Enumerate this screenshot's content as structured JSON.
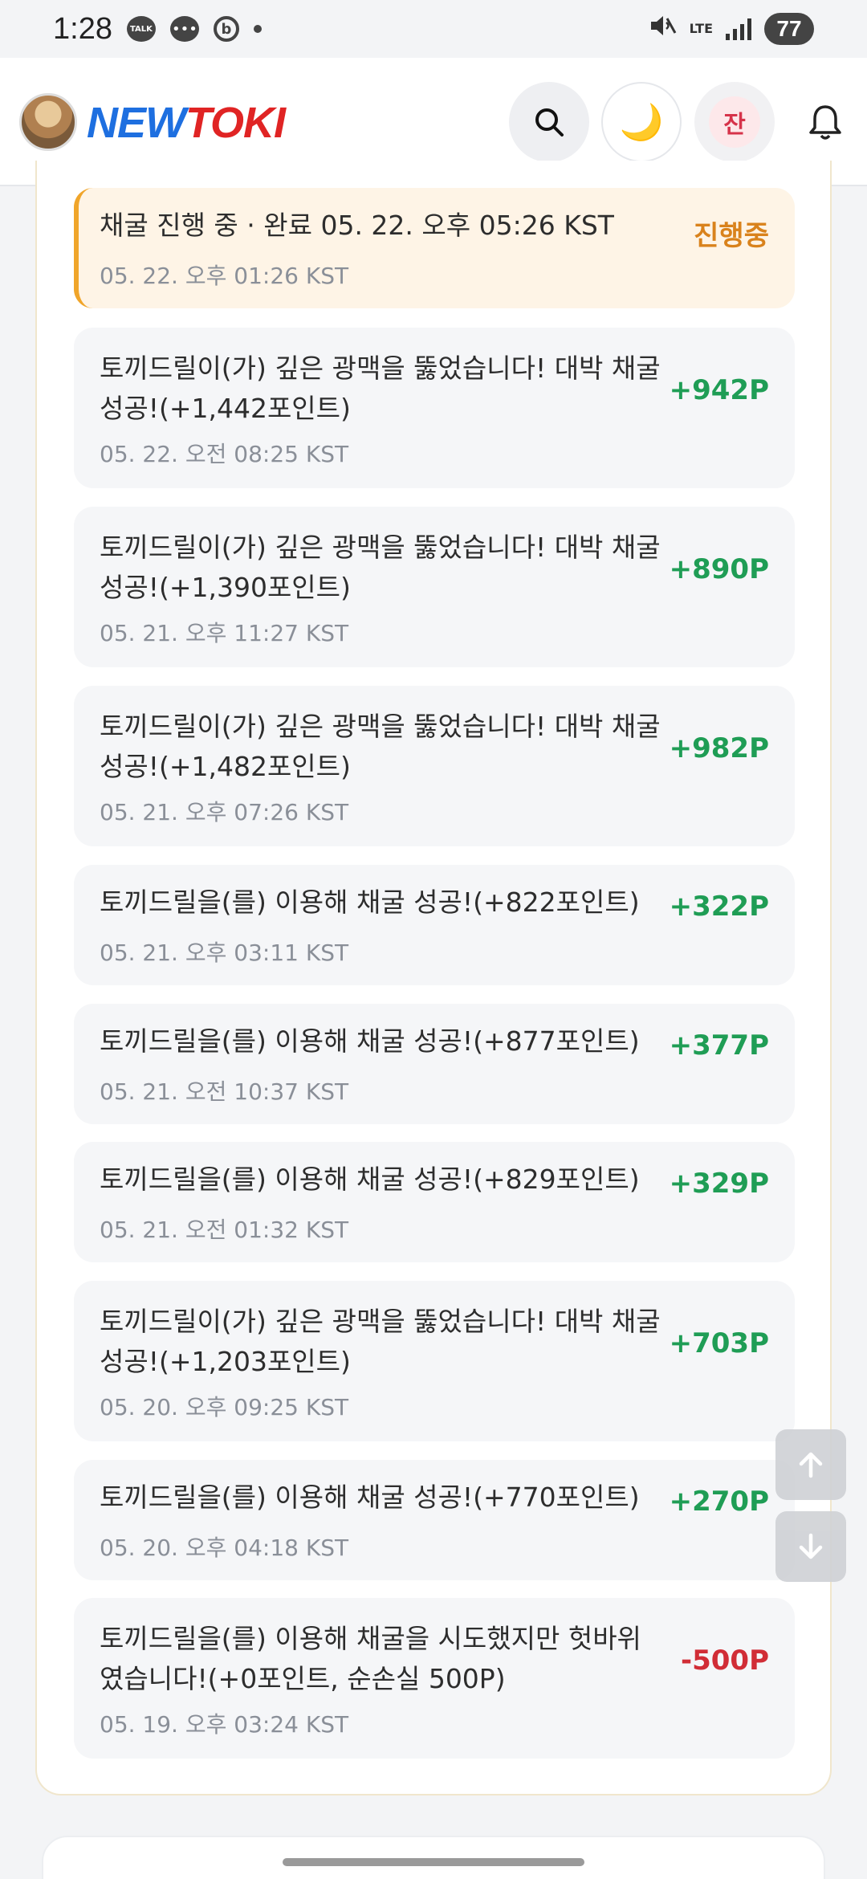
{
  "status_bar": {
    "time": "1:28",
    "talk_badge": "TALK",
    "chat_glyph": "•••",
    "b_glyph": "b",
    "network": "LTE",
    "battery": "77"
  },
  "header": {
    "logo_new": "NEW",
    "logo_toki": "TOKI",
    "search_icon": "search-icon",
    "moon_glyph": "🌙",
    "jan_label": "잔"
  },
  "history": [
    {
      "title": "채굴 진행 중 · 완료 05. 22. 오후 05:26 KST",
      "date": "05. 22. 오후 01:26 KST",
      "amount": "진행중",
      "status": "progress"
    },
    {
      "title": "토끼드릴이(가) 깊은 광맥을 뚫었습니다! 대박 채굴 성공!(+1,442포인트)",
      "date": "05. 22. 오전 08:25 KST",
      "amount": "+942P",
      "status": "pos"
    },
    {
      "title": "토끼드릴이(가) 깊은 광맥을 뚫었습니다! 대박 채굴 성공!(+1,390포인트)",
      "date": "05. 21. 오후 11:27 KST",
      "amount": "+890P",
      "status": "pos"
    },
    {
      "title": "토끼드릴이(가) 깊은 광맥을 뚫었습니다! 대박 채굴 성공!(+1,482포인트)",
      "date": "05. 21. 오후 07:26 KST",
      "amount": "+982P",
      "status": "pos"
    },
    {
      "title": "토끼드릴을(를) 이용해 채굴 성공!(+822포인트)",
      "date": "05. 21. 오후 03:11 KST",
      "amount": "+322P",
      "status": "pos"
    },
    {
      "title": "토끼드릴을(를) 이용해 채굴 성공!(+877포인트)",
      "date": "05. 21. 오전 10:37 KST",
      "amount": "+377P",
      "status": "pos"
    },
    {
      "title": "토끼드릴을(를) 이용해 채굴 성공!(+829포인트)",
      "date": "05. 21. 오전 01:32 KST",
      "amount": "+329P",
      "status": "pos"
    },
    {
      "title": "토끼드릴이(가) 깊은 광맥을 뚫었습니다! 대박 채굴 성공!(+1,203포인트)",
      "date": "05. 20. 오후 09:25 KST",
      "amount": "+703P",
      "status": "pos"
    },
    {
      "title": "토끼드릴을(를) 이용해 채굴 성공!(+770포인트)",
      "date": "05. 20. 오후 04:18 KST",
      "amount": "+270P",
      "status": "pos"
    },
    {
      "title": "토끼드릴을(를) 이용해 채굴을 시도했지만 헛바위였습니다!(+0포인트, 순손실 500P)",
      "date": "05. 19. 오후 03:24 KST",
      "amount": "-500P",
      "status": "neg"
    }
  ],
  "scroll": {
    "up_glyph": "↑",
    "down_glyph": "↓"
  },
  "colors": {
    "positive": "#1f9d55",
    "negative": "#d12d36",
    "progress": "#d9821c",
    "logo_blue": "#1e6fe0",
    "logo_red": "#e02424"
  }
}
